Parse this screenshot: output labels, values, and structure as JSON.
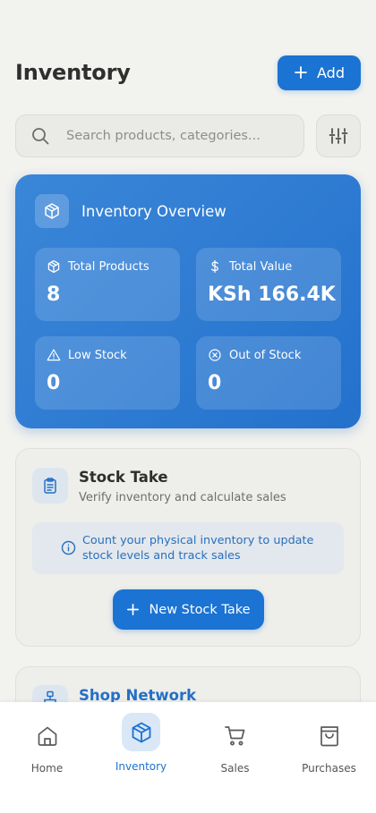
{
  "header": {
    "title": "Inventory",
    "add_label": "Add"
  },
  "search": {
    "placeholder": "Search products, categories..."
  },
  "overview": {
    "title": "Inventory Overview",
    "stats": [
      {
        "label": "Total Products",
        "value": "8",
        "icon": "box-icon"
      },
      {
        "label": "Total Value",
        "value": "KSh 166.4K",
        "icon": "dollar-icon"
      },
      {
        "label": "Low Stock",
        "value": "0",
        "icon": "warning-icon"
      },
      {
        "label": "Out of Stock",
        "value": "0",
        "icon": "x-circle-icon"
      }
    ]
  },
  "stock_take": {
    "title": "Stock Take",
    "subtitle": "Verify inventory and calculate sales",
    "info": "Count your physical inventory to update stock levels and track sales",
    "button_label": "New Stock Take"
  },
  "shop_network": {
    "title": "Shop Network"
  },
  "nav": {
    "items": [
      {
        "label": "Home",
        "icon": "home-icon"
      },
      {
        "label": "Inventory",
        "icon": "box-icon",
        "active": true
      },
      {
        "label": "Sales",
        "icon": "cart-icon"
      },
      {
        "label": "Purchases",
        "icon": "bag-icon"
      }
    ]
  },
  "colors": {
    "accent": "#1b73d3",
    "background": "#f2f2ef",
    "overview_card": "#2e7bd2"
  }
}
